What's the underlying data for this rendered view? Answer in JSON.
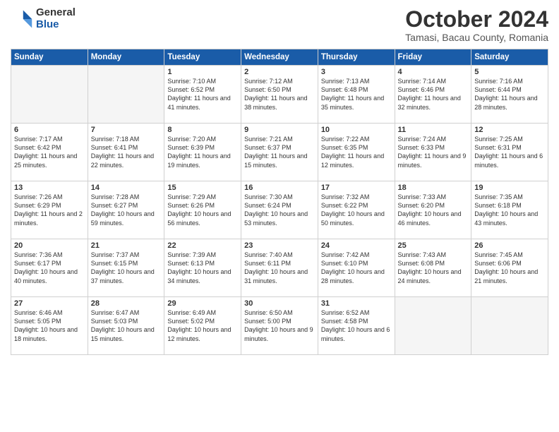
{
  "header": {
    "title": "October 2024",
    "location": "Tamasi, Bacau County, Romania",
    "logo_general": "General",
    "logo_blue": "Blue"
  },
  "days_of_week": [
    "Sunday",
    "Monday",
    "Tuesday",
    "Wednesday",
    "Thursday",
    "Friday",
    "Saturday"
  ],
  "weeks": [
    [
      {
        "day": "",
        "empty": true
      },
      {
        "day": "",
        "empty": true
      },
      {
        "day": "1",
        "sunrise": "7:10 AM",
        "sunset": "6:52 PM",
        "daylight": "11 hours and 41 minutes."
      },
      {
        "day": "2",
        "sunrise": "7:12 AM",
        "sunset": "6:50 PM",
        "daylight": "11 hours and 38 minutes."
      },
      {
        "day": "3",
        "sunrise": "7:13 AM",
        "sunset": "6:48 PM",
        "daylight": "11 hours and 35 minutes."
      },
      {
        "day": "4",
        "sunrise": "7:14 AM",
        "sunset": "6:46 PM",
        "daylight": "11 hours and 32 minutes."
      },
      {
        "day": "5",
        "sunrise": "7:16 AM",
        "sunset": "6:44 PM",
        "daylight": "11 hours and 28 minutes."
      }
    ],
    [
      {
        "day": "6",
        "sunrise": "7:17 AM",
        "sunset": "6:42 PM",
        "daylight": "11 hours and 25 minutes."
      },
      {
        "day": "7",
        "sunrise": "7:18 AM",
        "sunset": "6:41 PM",
        "daylight": "11 hours and 22 minutes."
      },
      {
        "day": "8",
        "sunrise": "7:20 AM",
        "sunset": "6:39 PM",
        "daylight": "11 hours and 19 minutes."
      },
      {
        "day": "9",
        "sunrise": "7:21 AM",
        "sunset": "6:37 PM",
        "daylight": "11 hours and 15 minutes."
      },
      {
        "day": "10",
        "sunrise": "7:22 AM",
        "sunset": "6:35 PM",
        "daylight": "11 hours and 12 minutes."
      },
      {
        "day": "11",
        "sunrise": "7:24 AM",
        "sunset": "6:33 PM",
        "daylight": "11 hours and 9 minutes."
      },
      {
        "day": "12",
        "sunrise": "7:25 AM",
        "sunset": "6:31 PM",
        "daylight": "11 hours and 6 minutes."
      }
    ],
    [
      {
        "day": "13",
        "sunrise": "7:26 AM",
        "sunset": "6:29 PM",
        "daylight": "11 hours and 2 minutes."
      },
      {
        "day": "14",
        "sunrise": "7:28 AM",
        "sunset": "6:27 PM",
        "daylight": "10 hours and 59 minutes."
      },
      {
        "day": "15",
        "sunrise": "7:29 AM",
        "sunset": "6:26 PM",
        "daylight": "10 hours and 56 minutes."
      },
      {
        "day": "16",
        "sunrise": "7:30 AM",
        "sunset": "6:24 PM",
        "daylight": "10 hours and 53 minutes."
      },
      {
        "day": "17",
        "sunrise": "7:32 AM",
        "sunset": "6:22 PM",
        "daylight": "10 hours and 50 minutes."
      },
      {
        "day": "18",
        "sunrise": "7:33 AM",
        "sunset": "6:20 PM",
        "daylight": "10 hours and 46 minutes."
      },
      {
        "day": "19",
        "sunrise": "7:35 AM",
        "sunset": "6:18 PM",
        "daylight": "10 hours and 43 minutes."
      }
    ],
    [
      {
        "day": "20",
        "sunrise": "7:36 AM",
        "sunset": "6:17 PM",
        "daylight": "10 hours and 40 minutes."
      },
      {
        "day": "21",
        "sunrise": "7:37 AM",
        "sunset": "6:15 PM",
        "daylight": "10 hours and 37 minutes."
      },
      {
        "day": "22",
        "sunrise": "7:39 AM",
        "sunset": "6:13 PM",
        "daylight": "10 hours and 34 minutes."
      },
      {
        "day": "23",
        "sunrise": "7:40 AM",
        "sunset": "6:11 PM",
        "daylight": "10 hours and 31 minutes."
      },
      {
        "day": "24",
        "sunrise": "7:42 AM",
        "sunset": "6:10 PM",
        "daylight": "10 hours and 28 minutes."
      },
      {
        "day": "25",
        "sunrise": "7:43 AM",
        "sunset": "6:08 PM",
        "daylight": "10 hours and 24 minutes."
      },
      {
        "day": "26",
        "sunrise": "7:45 AM",
        "sunset": "6:06 PM",
        "daylight": "10 hours and 21 minutes."
      }
    ],
    [
      {
        "day": "27",
        "sunrise": "6:46 AM",
        "sunset": "5:05 PM",
        "daylight": "10 hours and 18 minutes."
      },
      {
        "day": "28",
        "sunrise": "6:47 AM",
        "sunset": "5:03 PM",
        "daylight": "10 hours and 15 minutes."
      },
      {
        "day": "29",
        "sunrise": "6:49 AM",
        "sunset": "5:02 PM",
        "daylight": "10 hours and 12 minutes."
      },
      {
        "day": "30",
        "sunrise": "6:50 AM",
        "sunset": "5:00 PM",
        "daylight": "10 hours and 9 minutes."
      },
      {
        "day": "31",
        "sunrise": "6:52 AM",
        "sunset": "4:58 PM",
        "daylight": "10 hours and 6 minutes."
      },
      {
        "day": "",
        "empty": true
      },
      {
        "day": "",
        "empty": true
      }
    ]
  ],
  "labels": {
    "sunrise": "Sunrise:",
    "sunset": "Sunset:",
    "daylight": "Daylight:"
  }
}
